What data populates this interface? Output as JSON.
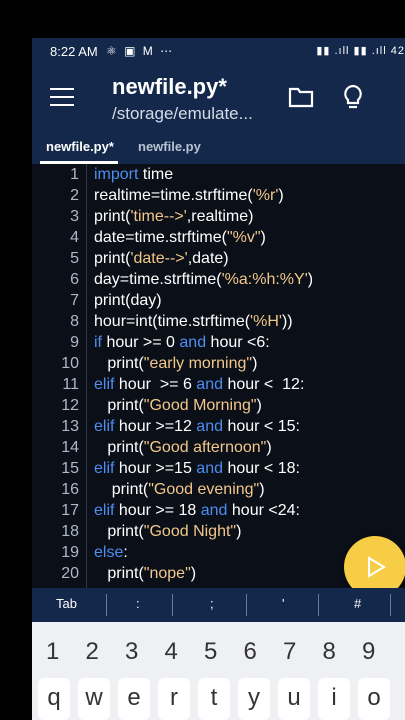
{
  "status": {
    "time": "8:22 AM",
    "left_icons": "⚛ ▣ M ⋯",
    "right_icons": "▮▮ .ıll ▮▮ .ıll 42"
  },
  "appbar": {
    "title": "newfile.py*",
    "subtitle": "/storage/emulate..."
  },
  "tabs": [
    {
      "label": "newfile.py*"
    },
    {
      "label": "newfile.py"
    }
  ],
  "code_lines": [
    {
      "n": "1",
      "segs": [
        [
          "kw",
          "import"
        ],
        [
          "t",
          " time"
        ]
      ]
    },
    {
      "n": "2",
      "segs": [
        [
          "t",
          "realtime=time.strftime("
        ],
        [
          "str",
          "'%r'"
        ],
        [
          "t",
          ")"
        ]
      ]
    },
    {
      "n": "3",
      "segs": [
        [
          "t",
          "print("
        ],
        [
          "str",
          "'time-->'"
        ],
        [
          "t",
          ",realtime)"
        ]
      ]
    },
    {
      "n": "4",
      "segs": [
        [
          "t",
          "date=time.strftime("
        ],
        [
          "str",
          "\"%v\""
        ],
        [
          "t",
          ")"
        ]
      ]
    },
    {
      "n": "5",
      "segs": [
        [
          "t",
          "print("
        ],
        [
          "str",
          "'date-->'"
        ],
        [
          "t",
          ",date)"
        ]
      ]
    },
    {
      "n": "6",
      "segs": [
        [
          "t",
          "day=time.strftime("
        ],
        [
          "str",
          "'%a:%h:%Y'"
        ],
        [
          "t",
          ")"
        ]
      ]
    },
    {
      "n": "7",
      "segs": [
        [
          "t",
          "print(day)"
        ]
      ]
    },
    {
      "n": "8",
      "segs": [
        [
          "t",
          "hour=int(time.strftime("
        ],
        [
          "str",
          "'%H'"
        ],
        [
          "t",
          "))"
        ]
      ]
    },
    {
      "n": "9",
      "segs": [
        [
          "kw",
          "if"
        ],
        [
          "t",
          " hour >= 0 "
        ],
        [
          "kw",
          "and"
        ],
        [
          "t",
          " hour <6:"
        ]
      ]
    },
    {
      "n": "10",
      "segs": [
        [
          "t",
          "   print("
        ],
        [
          "str",
          "\"early morning\""
        ],
        [
          "t",
          ")"
        ]
      ]
    },
    {
      "n": "11",
      "segs": [
        [
          "kw",
          "elif"
        ],
        [
          "t",
          " hour  >= 6 "
        ],
        [
          "kw",
          "and"
        ],
        [
          "t",
          " hour <  12:"
        ]
      ]
    },
    {
      "n": "12",
      "segs": [
        [
          "t",
          "   print("
        ],
        [
          "str",
          "\"Good Morning\""
        ],
        [
          "t",
          ")"
        ]
      ]
    },
    {
      "n": "13",
      "segs": [
        [
          "kw",
          "elif"
        ],
        [
          "t",
          " hour >=12 "
        ],
        [
          "kw",
          "and"
        ],
        [
          "t",
          " hour < 15:"
        ]
      ]
    },
    {
      "n": "14",
      "segs": [
        [
          "t",
          "   print("
        ],
        [
          "str",
          "\"Good afternoon\""
        ],
        [
          "t",
          ")"
        ]
      ]
    },
    {
      "n": "15",
      "segs": [
        [
          "kw",
          "elif"
        ],
        [
          "t",
          " hour >=15 "
        ],
        [
          "kw",
          "and"
        ],
        [
          "t",
          " hour < 18:"
        ]
      ]
    },
    {
      "n": "16",
      "segs": [
        [
          "t",
          "    print("
        ],
        [
          "str",
          "\"Good evening\""
        ],
        [
          "t",
          ")"
        ]
      ]
    },
    {
      "n": "17",
      "segs": [
        [
          "kw",
          "elif"
        ],
        [
          "t",
          " hour >= 18 "
        ],
        [
          "kw",
          "and"
        ],
        [
          "t",
          " hour <24:"
        ]
      ]
    },
    {
      "n": "18",
      "segs": [
        [
          "t",
          "   print("
        ],
        [
          "str",
          "\"Good Night\""
        ],
        [
          "t",
          ")"
        ]
      ]
    },
    {
      "n": "19",
      "segs": [
        [
          "kw",
          "else"
        ],
        [
          "t",
          ":"
        ]
      ]
    },
    {
      "n": "20",
      "segs": [
        [
          "t",
          "   print("
        ],
        [
          "str",
          "\"nope\""
        ],
        [
          "t",
          ")"
        ]
      ]
    }
  ],
  "extra_keys": [
    "Tab",
    ":",
    ";",
    "'",
    "#"
  ],
  "number_row": [
    "1",
    "2",
    "3",
    "4",
    "5",
    "6",
    "7",
    "8",
    "9"
  ],
  "letter_row": [
    "q",
    "w",
    "e",
    "r",
    "t",
    "y",
    "u",
    "i",
    "o"
  ],
  "colors": {
    "appbar": "#13284a",
    "keyword": "#4d8ef0",
    "string": "#f3c78a",
    "fab": "#f6cd45"
  }
}
